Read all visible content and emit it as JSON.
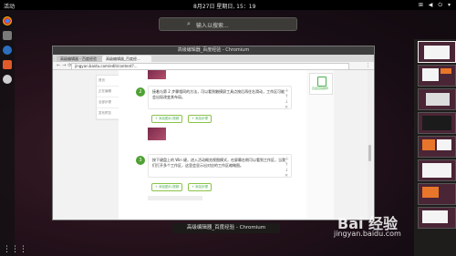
{
  "topbar": {
    "activities": "活动",
    "clock": "8月27日 星期日, 15：19",
    "status_icons": "⊞ ◀ ⏻ ▾"
  },
  "search": {
    "placeholder": "输入以搜索...",
    "icon": "search-icon"
  },
  "dock": {
    "items": [
      "chrome-icon",
      "files-icon",
      "terminal-icon",
      "firefox-icon",
      "settings-icon",
      "app-grid-icon"
    ]
  },
  "browser": {
    "title": "高级编辑器_百度经验 - Chromium",
    "tabs": [
      {
        "label": "高级编辑器 - 百度经验"
      },
      {
        "label": "高级编辑器_百度经..."
      }
    ],
    "url": "jingyan.baidu.com/edit/content?...",
    "left_nav": [
      "首页",
      "正在编辑",
      "全部步骤",
      "发布预览"
    ],
    "steps": [
      {
        "num": "2",
        "text": "接着与第 2 步骤相同的方法，可以看到触摸屏工具点按后再往右滑动，工作区可能会出现改变其布局。",
        "add_image": "+ 添加图片/视频",
        "add_text": "+ 添加步骤"
      },
      {
        "num": "3",
        "text": "按下键盘上的 Win 键，进入活动概览视图模式，在屏幕右侧可以看到工作区，当我们打开多个工作区，这里会显示出对应的工作区缩略图。",
        "add_image": "+ 添加图片/视频",
        "add_text": "+ 添加步骤"
      }
    ],
    "side_icons": [
      "＋",
      "↑",
      "↓",
      "✕"
    ],
    "recommend": "百度经验推荐"
  },
  "tooltip": "高级编辑器_百度经验 - Chromium",
  "watermark": {
    "brand": "Bai 经验",
    "site": "jingyan.baidu.com"
  },
  "workspaces": {
    "count": 8,
    "selected_index": 0
  }
}
